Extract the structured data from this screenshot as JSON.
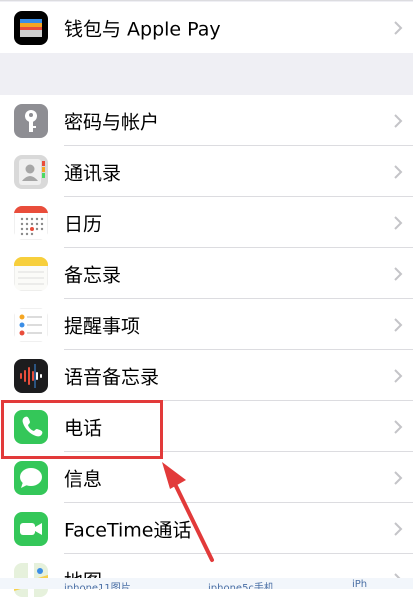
{
  "group1": {
    "items": [
      {
        "label": "钱包与 Apple Pay",
        "icon": "wallet-icon"
      }
    ]
  },
  "group2": {
    "items": [
      {
        "label": "密码与帐户",
        "icon": "key-icon"
      },
      {
        "label": "通讯录",
        "icon": "contacts-icon"
      },
      {
        "label": "日历",
        "icon": "calendar-icon"
      },
      {
        "label": "备忘录",
        "icon": "notes-icon"
      },
      {
        "label": "提醒事项",
        "icon": "reminders-icon"
      },
      {
        "label": "语音备忘录",
        "icon": "voice-memos-icon"
      },
      {
        "label": "电话",
        "icon": "phone-icon"
      },
      {
        "label": "信息",
        "icon": "messages-icon"
      },
      {
        "label": "FaceTime通话",
        "icon": "facetime-icon"
      },
      {
        "label": "地图",
        "icon": "maps-icon"
      }
    ]
  },
  "colors": {
    "background": "#efeff4",
    "highlight": "#e23a3a",
    "phone_green": "#34c759"
  },
  "bottom_strip": {
    "items": [
      "iphone11图片",
      "iphone5c手机",
      "iPh"
    ]
  }
}
